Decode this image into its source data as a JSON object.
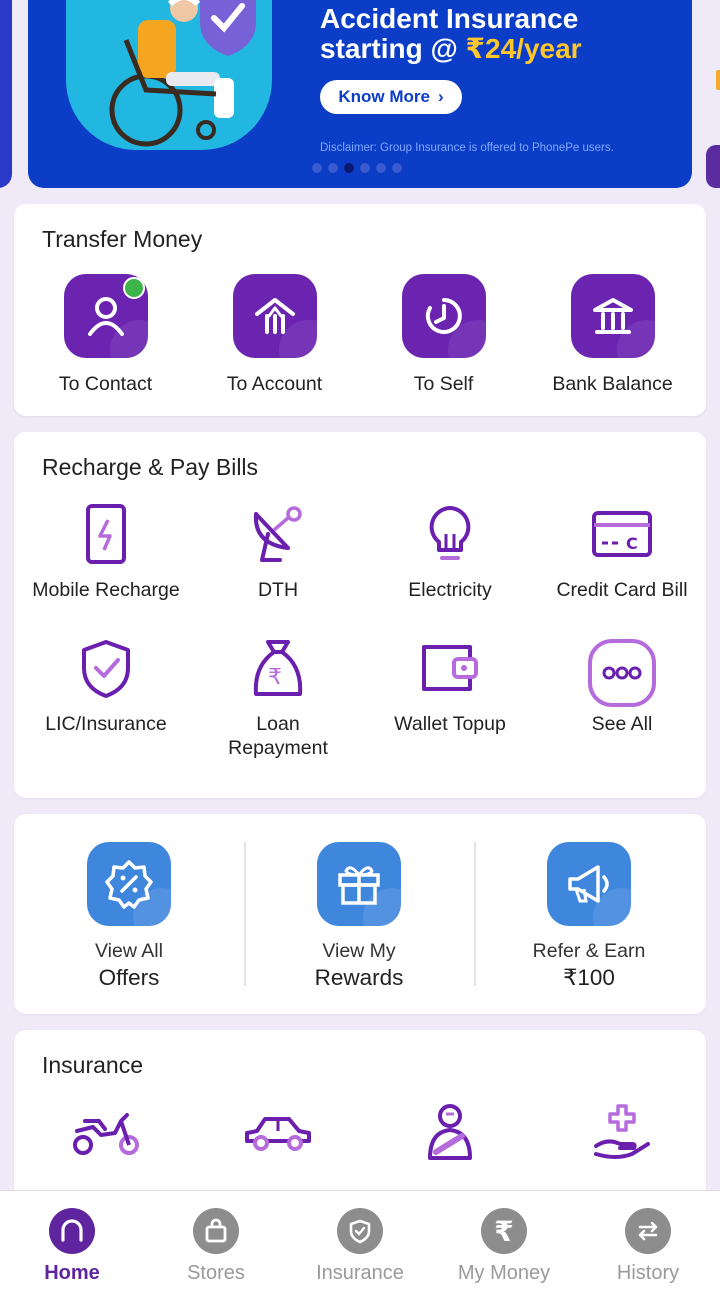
{
  "banner": {
    "title_line1": "Accident Insurance",
    "title_line2_prefix": "starting @ ",
    "title_line2_highlight": "₹24/year",
    "cta_label": "Know More",
    "cta_icon": "chevron-right-icon",
    "disclaimer": "Disclaimer: Group Insurance is offered to PhonePe users.",
    "carousel_pages": 6,
    "carousel_active": 3,
    "colors": {
      "background": "#0c3dc7",
      "highlight": "#ffc72c"
    }
  },
  "transfer": {
    "title": "Transfer Money",
    "items": [
      {
        "label": "To Contact",
        "icon": "contact-person-icon",
        "online_badge": true
      },
      {
        "label": "To Account",
        "icon": "bank-account-icon"
      },
      {
        "label": "To Self",
        "icon": "self-transfer-icon"
      },
      {
        "label": "Bank Balance",
        "icon": "bank-building-icon"
      }
    ],
    "colors": {
      "tile": "#6b24b0",
      "badge": "#3cb44a"
    }
  },
  "bills": {
    "title": "Recharge & Pay Bills",
    "items": [
      {
        "label": "Mobile Recharge",
        "icon": "mobile-recharge-icon"
      },
      {
        "label": "DTH",
        "icon": "satellite-dish-icon"
      },
      {
        "label": "Electricity",
        "icon": "lightbulb-icon"
      },
      {
        "label": "Credit Card Bill",
        "icon": "credit-card-icon"
      },
      {
        "label": "LIC/Insurance",
        "icon": "shield-check-icon"
      },
      {
        "label": "Loan\nRepayment",
        "icon": "money-bag-icon"
      },
      {
        "label": "Wallet Topup",
        "icon": "wallet-icon"
      },
      {
        "label": "See All",
        "icon": "more-dots-icon"
      }
    ]
  },
  "offers": {
    "items": [
      {
        "line1": "View All",
        "line2": "Offers",
        "icon": "offer-badge-icon"
      },
      {
        "line1": "View My",
        "line2": "Rewards",
        "icon": "gift-icon"
      },
      {
        "line1": "Refer & Earn",
        "line2": "₹100",
        "icon": "megaphone-icon"
      }
    ],
    "colors": {
      "tile": "#3f86dd"
    }
  },
  "insurance": {
    "title": "Insurance",
    "items": [
      {
        "icon": "bike-icon"
      },
      {
        "icon": "car-icon"
      },
      {
        "icon": "accident-person-icon"
      },
      {
        "icon": "health-hand-icon"
      }
    ]
  },
  "bottom_nav": {
    "items": [
      {
        "label": "Home",
        "icon": "home-icon",
        "active": true
      },
      {
        "label": "Stores",
        "icon": "shopping-bag-icon"
      },
      {
        "label": "Insurance",
        "icon": "shield-icon"
      },
      {
        "label": "My Money",
        "icon": "rupee-icon"
      },
      {
        "label": "History",
        "icon": "swap-arrows-icon"
      }
    ],
    "colors": {
      "active": "#5f259f",
      "inactive": "#8d8d8d"
    }
  }
}
